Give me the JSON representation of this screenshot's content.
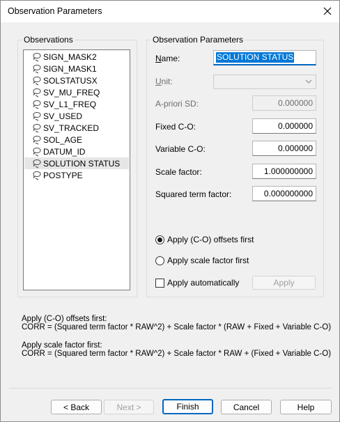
{
  "window": {
    "title": "Observation Parameters"
  },
  "observations": {
    "group_label": "Observations",
    "items": [
      {
        "label": "SIGN_MASK2",
        "selected": false
      },
      {
        "label": "SIGN_MASK1",
        "selected": false
      },
      {
        "label": "SOLSTATUSX",
        "selected": false
      },
      {
        "label": "SV_MU_FREQ",
        "selected": false
      },
      {
        "label": "SV_L1_FREQ",
        "selected": false
      },
      {
        "label": "SV_USED",
        "selected": false
      },
      {
        "label": "SV_TRACKED",
        "selected": false
      },
      {
        "label": "SOL_AGE",
        "selected": false
      },
      {
        "label": "DATUM_ID",
        "selected": false
      },
      {
        "label": "SOLUTION STATUS",
        "selected": true
      },
      {
        "label": "POSTYPE",
        "selected": false
      }
    ]
  },
  "params": {
    "group_label": "Observation Parameters",
    "name_label": "Name:",
    "name_value": "SOLUTION STATUS",
    "unit_label": "Unit:",
    "unit_value": "",
    "apriori_label": "A-priori SD:",
    "apriori_value": "0.000000",
    "fixed_label": "Fixed C-O:",
    "fixed_value": "0.000000",
    "variable_label": "Variable C-O:",
    "variable_value": "0.000000",
    "scale_label": "Scale factor:",
    "scale_value": "1.000000000",
    "squared_label": "Squared term factor:",
    "squared_value": "0.000000000",
    "radio_offsets_label": "Apply (C-O) offsets first",
    "radio_offsets_checked": true,
    "radio_scale_label": "Apply scale factor first",
    "radio_scale_checked": false,
    "auto_label": "Apply automatically",
    "auto_checked": false,
    "apply_label": "Apply"
  },
  "description": {
    "offsets_title": "Apply (C-O) offsets first:",
    "offsets_formula": "CORR = (Squared term factor * RAW^2) + Scale factor * (RAW + Fixed + Variable C-O)",
    "scale_title": "Apply scale factor first:",
    "scale_formula": "CORR = (Squared term factor * RAW^2) + Scale factor * RAW + (Fixed + Variable C-O)"
  },
  "buttons": {
    "back": "< Back",
    "next": "Next >",
    "finish": "Finish",
    "cancel": "Cancel",
    "help": "Help"
  }
}
